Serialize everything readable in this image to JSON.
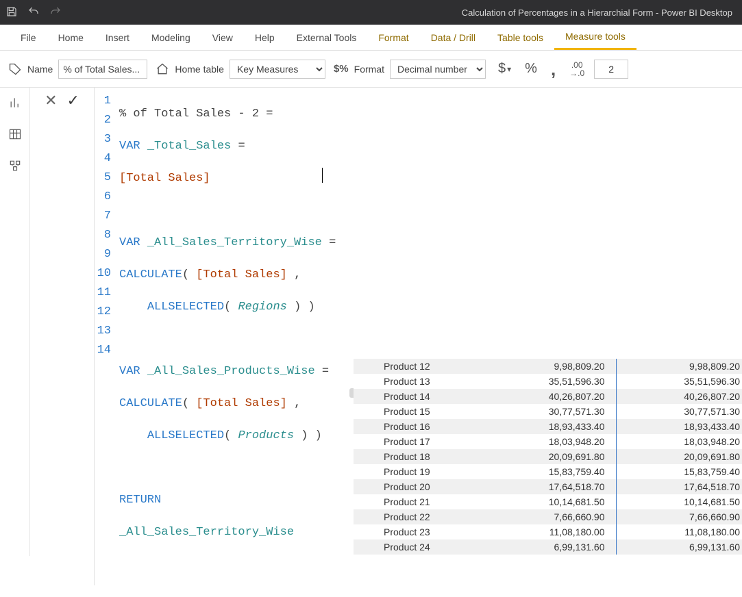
{
  "titlebar": {
    "title": "Calculation of Percentages in a Hierarchial Form - Power BI Desktop"
  },
  "tabs": {
    "file": "File",
    "home": "Home",
    "insert": "Insert",
    "modeling": "Modeling",
    "view": "View",
    "help": "Help",
    "external": "External Tools",
    "format": "Format",
    "datadrill": "Data / Drill",
    "tabletools": "Table tools",
    "measuretools": "Measure tools"
  },
  "ribbon": {
    "name_label": "Name",
    "name_value": "% of Total Sales...",
    "hometable_label": "Home table",
    "hometable_value": "Key Measures",
    "format_label": "Format",
    "format_value": "Decimal number",
    "currency": "$",
    "percent": "%",
    "comma": ",",
    "decplaces": "2"
  },
  "formula": {
    "lines": [
      "% of Total Sales - 2 =",
      "VAR _Total_Sales =",
      "[Total Sales]",
      "",
      "VAR _All_Sales_Territory_Wise =",
      "CALCULATE( [Total Sales] ,",
      "    ALLSELECTED( Regions ) )",
      "",
      "VAR _All_Sales_Products_Wise =",
      "CALCULATE( [Total Sales] ,",
      "    ALLSELECTED( Products ) )",
      "",
      "RETURN",
      "_All_Sales_Territory_Wise"
    ]
  },
  "table": {
    "rows": [
      {
        "p": "Product 12",
        "v1": "9,98,809.20",
        "v2": "9,98,809.20"
      },
      {
        "p": "Product 13",
        "v1": "35,51,596.30",
        "v2": "35,51,596.30"
      },
      {
        "p": "Product 14",
        "v1": "40,26,807.20",
        "v2": "40,26,807.20"
      },
      {
        "p": "Product 15",
        "v1": "30,77,571.30",
        "v2": "30,77,571.30"
      },
      {
        "p": "Product 16",
        "v1": "18,93,433.40",
        "v2": "18,93,433.40"
      },
      {
        "p": "Product 17",
        "v1": "18,03,948.20",
        "v2": "18,03,948.20"
      },
      {
        "p": "Product 18",
        "v1": "20,09,691.80",
        "v2": "20,09,691.80"
      },
      {
        "p": "Product 19",
        "v1": "15,83,759.40",
        "v2": "15,83,759.40"
      },
      {
        "p": "Product 20",
        "v1": "17,64,518.70",
        "v2": "17,64,518.70"
      },
      {
        "p": "Product 21",
        "v1": "10,14,681.50",
        "v2": "10,14,681.50"
      },
      {
        "p": "Product 22",
        "v1": "7,66,660.90",
        "v2": "7,66,660.90"
      },
      {
        "p": "Product 23",
        "v1": "11,08,180.00",
        "v2": "11,08,180.00"
      },
      {
        "p": "Product 24",
        "v1": "6,99,131.60",
        "v2": "6,99,131.60"
      }
    ]
  }
}
